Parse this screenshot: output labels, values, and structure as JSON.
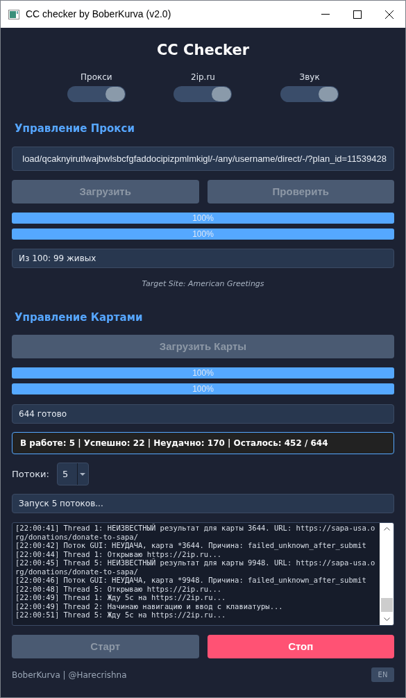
{
  "window": {
    "title": "CC checker by BoberKurva (v2.0)"
  },
  "heading": "CC Checker",
  "toggles": [
    {
      "label": "Прокси",
      "on": true
    },
    {
      "label": "2ip.ru",
      "on": true
    },
    {
      "label": "Звук",
      "on": true
    }
  ],
  "proxy_section": {
    "title": "Управление Прокси",
    "url_value": "load/qcaknyirutlwajbwlsbcfgfaddocipizpmlmkigl/-/any/username/direct/-/?plan_id=11539428",
    "buttons": [
      {
        "label": "Загрузить",
        "disabled": true
      },
      {
        "label": "Проверить",
        "disabled": true
      }
    ],
    "progress": [
      {
        "level": 1,
        "reading": "100%"
      },
      {
        "level": 1,
        "reading": "100%"
      }
    ],
    "status": "Из 100: 99 живых",
    "target": "Target Site: American Greetings"
  },
  "cards_section": {
    "title": "Управление Картами",
    "button": {
      "label": "Загрузить Карты",
      "disabled": true
    },
    "progress": [
      {
        "level": 1,
        "reading": "100%"
      },
      {
        "level": 1,
        "reading": "100%"
      }
    ],
    "status": "644 готово",
    "stats": "В работе: 5 | Успешно: 22 | Неудачно: 170 | Осталось: 452 / 644",
    "threads_label": "Потоки:",
    "threads_value": "5",
    "run_status": "Запуск 5 потоков..."
  },
  "log": [
    "[22:00:41] Thread 1: НЕИЗВЕСТНЫЙ результат для карты 3644. URL: https://sapa-usa.org/donations/donate-to-sapa/",
    "[22:00:42] Поток GUI: НЕУДАЧА, карта *3644. Причина: failed_unknown_after_submit",
    "[22:00:44] Thread 1: Открываю https://2ip.ru...",
    "[22:00:45] Thread 5: НЕИЗВЕСТНЫЙ результат для карты 9948. URL: https://sapa-usa.org/donations/donate-to-sapa/",
    "[22:00:46] Поток GUI: НЕУДАЧА, карта *9948. Причина: failed_unknown_after_submit",
    "[22:00:48] Thread 5: Открываю https://2ip.ru...",
    "[22:00:49] Thread 1: Жду 5с на https://2ip.ru...",
    "[22:00:49] Thread 2: Начинаю навигацию и ввод с клавиатуры...",
    "[22:00:51] Thread 5: Жду 5с на https://2ip.ru..."
  ],
  "actions": [
    {
      "label": "Старт",
      "kind": "start",
      "disabled": true
    },
    {
      "label": "Стоп",
      "kind": "stop",
      "disabled": false
    }
  ],
  "footer": {
    "credit": "BoberKurva | @Harecrishna",
    "language": "EN"
  }
}
